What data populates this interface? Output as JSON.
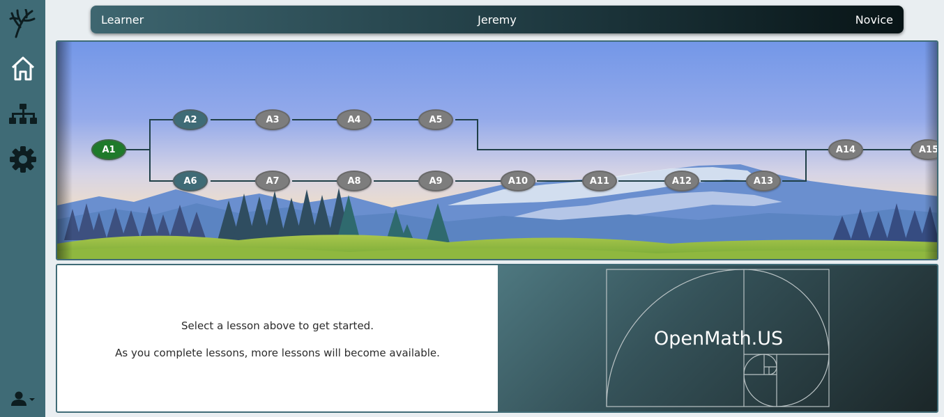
{
  "sidebar": {
    "logo_icon": "tree-branch-icon",
    "items": [
      {
        "name": "home",
        "icon": "home-icon"
      },
      {
        "name": "hierarchy",
        "icon": "sitemap-icon"
      },
      {
        "name": "settings",
        "icon": "gear-icon"
      }
    ],
    "user_icon": "user-icon",
    "user_dropdown_icon": "caret-down-icon"
  },
  "header": {
    "left_label": "Learner",
    "center_label": "Jeremy",
    "right_label": "Novice"
  },
  "lesson_map": {
    "nodes": [
      {
        "id": "A1",
        "status": "current"
      },
      {
        "id": "A2",
        "status": "available"
      },
      {
        "id": "A3",
        "status": "locked"
      },
      {
        "id": "A4",
        "status": "locked"
      },
      {
        "id": "A5",
        "status": "locked"
      },
      {
        "id": "A6",
        "status": "available"
      },
      {
        "id": "A7",
        "status": "locked"
      },
      {
        "id": "A8",
        "status": "locked"
      },
      {
        "id": "A9",
        "status": "locked"
      },
      {
        "id": "A10",
        "status": "locked"
      },
      {
        "id": "A11",
        "status": "locked"
      },
      {
        "id": "A12",
        "status": "locked"
      },
      {
        "id": "A13",
        "status": "locked"
      },
      {
        "id": "A14",
        "status": "locked"
      },
      {
        "id": "A15",
        "status": "locked"
      }
    ],
    "status_colors": {
      "current": "#1e7a2a",
      "available": "#3f6b76",
      "locked": "#7d7d7d"
    }
  },
  "info": {
    "line1": "Select a lesson above to get started.",
    "line2": "As you complete lessons, more lessons will become available."
  },
  "brand": {
    "name": "OpenMath.US"
  },
  "colors": {
    "sidebar": "#3f6b76",
    "accent": "#3f6b76"
  }
}
